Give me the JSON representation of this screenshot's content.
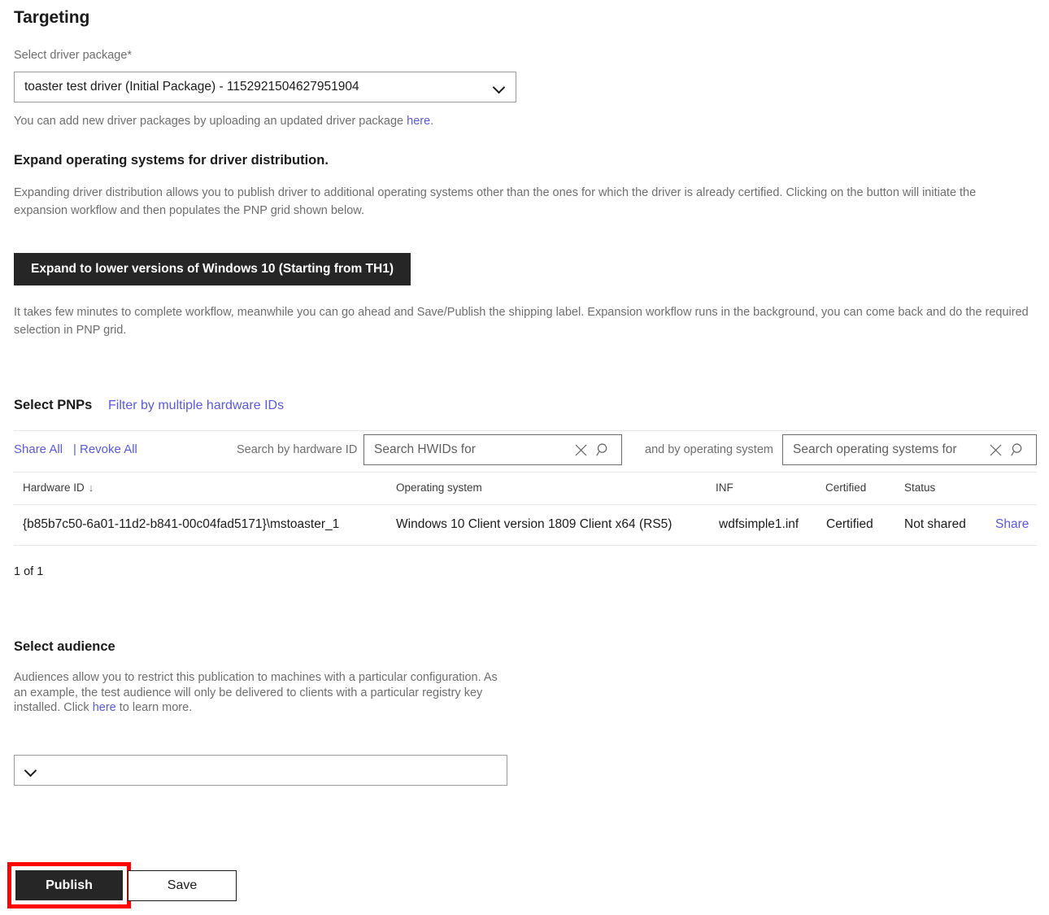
{
  "page": {
    "title": "Targeting"
  },
  "driver_package": {
    "label": "Select driver package*",
    "selected": "toaster test driver (Initial Package) - 1152921504627951904",
    "help_prefix": "You can add new driver packages by uploading an updated driver package ",
    "help_link": "here",
    "help_suffix": "."
  },
  "expand_section": {
    "heading": "Expand operating systems for driver distribution.",
    "description": "Expanding driver distribution allows you to publish driver to additional operating systems other than the ones for which the driver is already certified. Clicking on the button will initiate the expansion workflow and then populates the PNP grid shown below.",
    "button_label": "Expand to lower versions of Windows 10 (Starting from TH1)",
    "note": "It takes few minutes to complete workflow, meanwhile you can go ahead and Save/Publish the shipping label. Expansion workflow runs in the background, you can come back and do the required selection in PNP grid."
  },
  "pnp": {
    "heading": "Select PNPs",
    "filter_link": "Filter by multiple hardware IDs",
    "share_all": "Share All",
    "separator": "|",
    "revoke_all": "Revoke All",
    "search_hwid_label": "Search by hardware ID",
    "search_hwid_value": "",
    "search_hwid_placeholder": "Search HWIDs for",
    "search_os_label": "and by operating system",
    "search_os_value": "",
    "search_os_placeholder": "Search operating systems for",
    "columns": [
      "Hardware ID",
      "Operating system",
      "INF",
      "Certified",
      "Status"
    ],
    "sort_indicator": "↓",
    "rows": [
      {
        "hardware_id": "{b85b7c50-6a01-11d2-b841-00c04fad5171}\\mstoaster_1",
        "operating_system": "Windows 10 Client version 1809 Client x64 (RS5)",
        "inf": "wdfsimple1.inf",
        "certified": "Certified",
        "status": "Not shared",
        "action": "Share"
      }
    ],
    "count_text": "1 of 1"
  },
  "audience": {
    "heading": "Select audience",
    "description_part1": "Audiences allow you to restrict this publication to machines with a particular configuration. As an example, the test audience will only be delivered to clients with a particular registry key installed. Click ",
    "description_link": "here",
    "description_part2": " to learn more.",
    "selected": ""
  },
  "footer": {
    "publish_label": "Publish",
    "save_label": "Save"
  },
  "icons": {
    "clear": "close-x-icon",
    "search": "magnifier-icon",
    "chevron": "chevron-down-icon"
  },
  "colors": {
    "link": "#5a5ad6",
    "dark_button": "#262626",
    "highlight": "#ff0000",
    "muted_text": "#6e6e6e",
    "rule": "#e6e6e6"
  }
}
